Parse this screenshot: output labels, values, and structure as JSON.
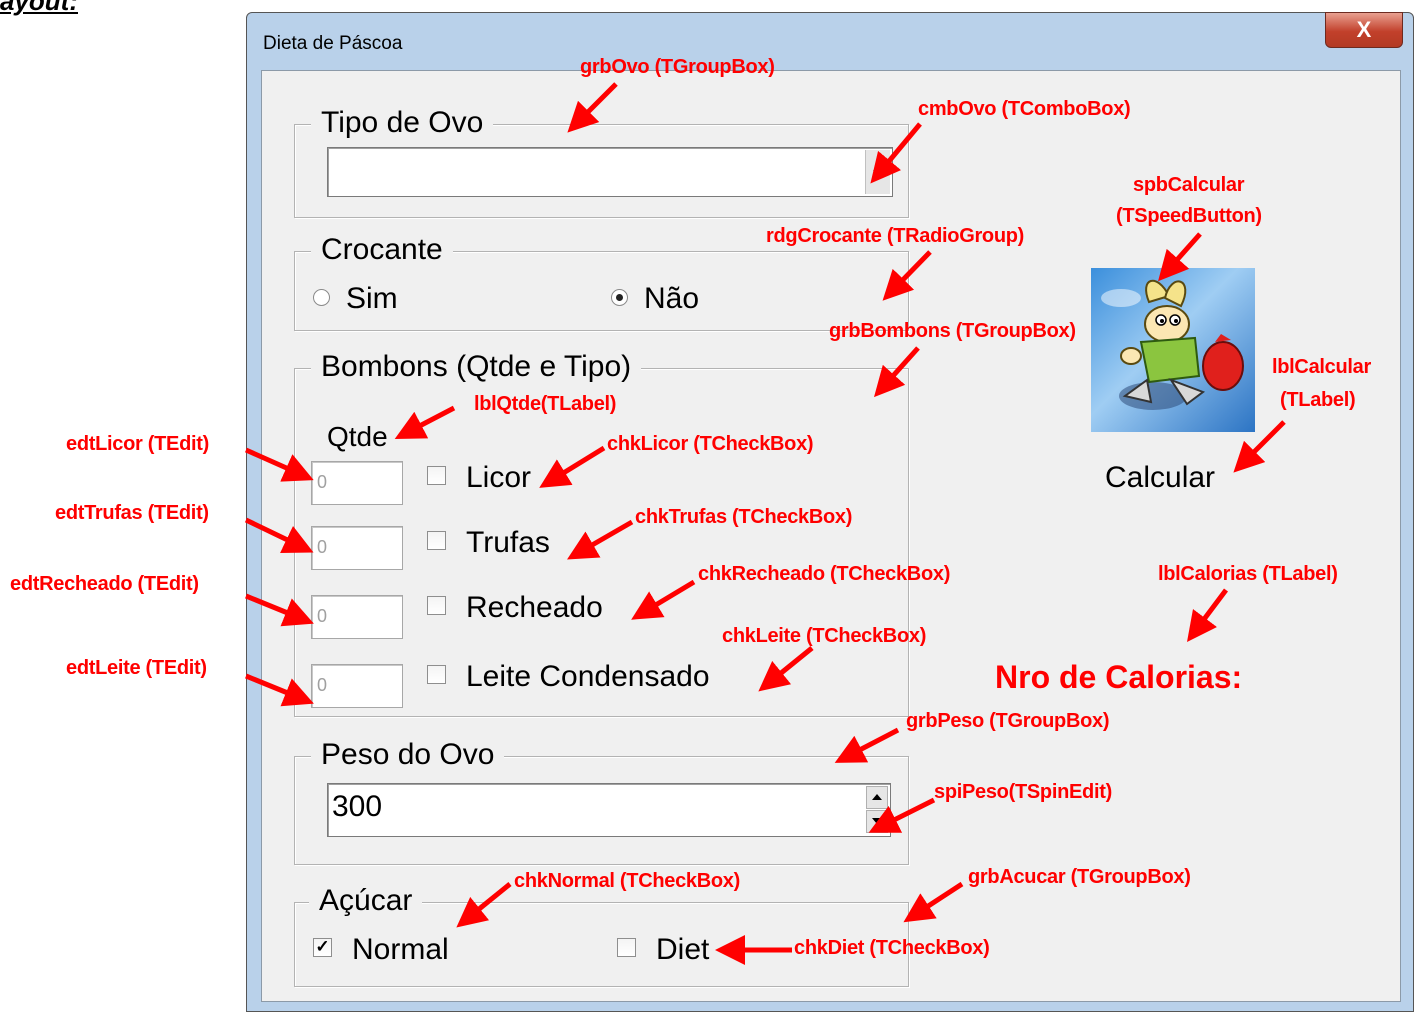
{
  "doc": {
    "heading": "ayout:"
  },
  "window": {
    "title": "Dieta de Páscoa",
    "close_label": "X"
  },
  "groups": {
    "ovo": {
      "caption": "Tipo de Ovo",
      "combo_value": ""
    },
    "crocante": {
      "caption": "Crocante",
      "options": [
        "Sim",
        "Não"
      ],
      "selected": "Não"
    },
    "bombons": {
      "caption": "Bombons (Qtde e Tipo)",
      "qtde_label": "Qtde",
      "items": [
        {
          "qty": "0",
          "label": "Licor",
          "checked": false
        },
        {
          "qty": "0",
          "label": "Trufas",
          "checked": false
        },
        {
          "qty": "0",
          "label": "Recheado",
          "checked": false
        },
        {
          "qty": "0",
          "label": "Leite Condensado",
          "checked": false
        }
      ]
    },
    "peso": {
      "caption": "Peso do Ovo",
      "value": "300"
    },
    "acucar": {
      "caption": "Açúcar",
      "normal_label": "Normal",
      "normal_checked": true,
      "diet_label": "Diet",
      "diet_checked": false
    }
  },
  "calcular": {
    "label": "Calcular",
    "button_image": "cartoon-rabbit-with-easter-egg"
  },
  "calorias": {
    "label": "Nro de Calorias:"
  },
  "annotations": {
    "grbOvo": "grbOvo (TGroupBox)",
    "cmbOvo": "cmbOvo (TComboBox)",
    "spbCalcular_1": "spbCalcular",
    "spbCalcular_2": "(TSpeedButton)",
    "rdgCrocante": "rdgCrocante (TRadioGroup)",
    "grbBombons": "grbBombons (TGroupBox)",
    "lblCalcular_1": "lblCalcular",
    "lblCalcular_2": "(TLabel)",
    "lblQtde": "lblQtde(TLabel)",
    "edtLicor": "edtLicor (TEdit)",
    "chkLicor": "chkLicor (TCheckBox)",
    "edtTrufas": "edtTrufas (TEdit)",
    "chkTrufas": "chkTrufas (TCheckBox)",
    "edtRecheado": "edtRecheado (TEdit)",
    "chkRecheado": "chkRecheado (TCheckBox)",
    "lblCalorias": "lblCalorias (TLabel)",
    "chkLeite": "chkLeite (TCheckBox)",
    "edtLeite": "edtLeite (TEdit)",
    "grbPeso": "grbPeso (TGroupBox)",
    "spiPeso": "spiPeso(TSpinEdit)",
    "chkNormal": "chkNormal (TCheckBox)",
    "grbAcucar": "grbAcucar (TGroupBox)",
    "chkDiet": "chkDiet (TCheckBox)"
  },
  "colors": {
    "annotation": "#ff0000",
    "window_frame": "#b9d1ea",
    "client_bg": "#f0f0f0"
  }
}
